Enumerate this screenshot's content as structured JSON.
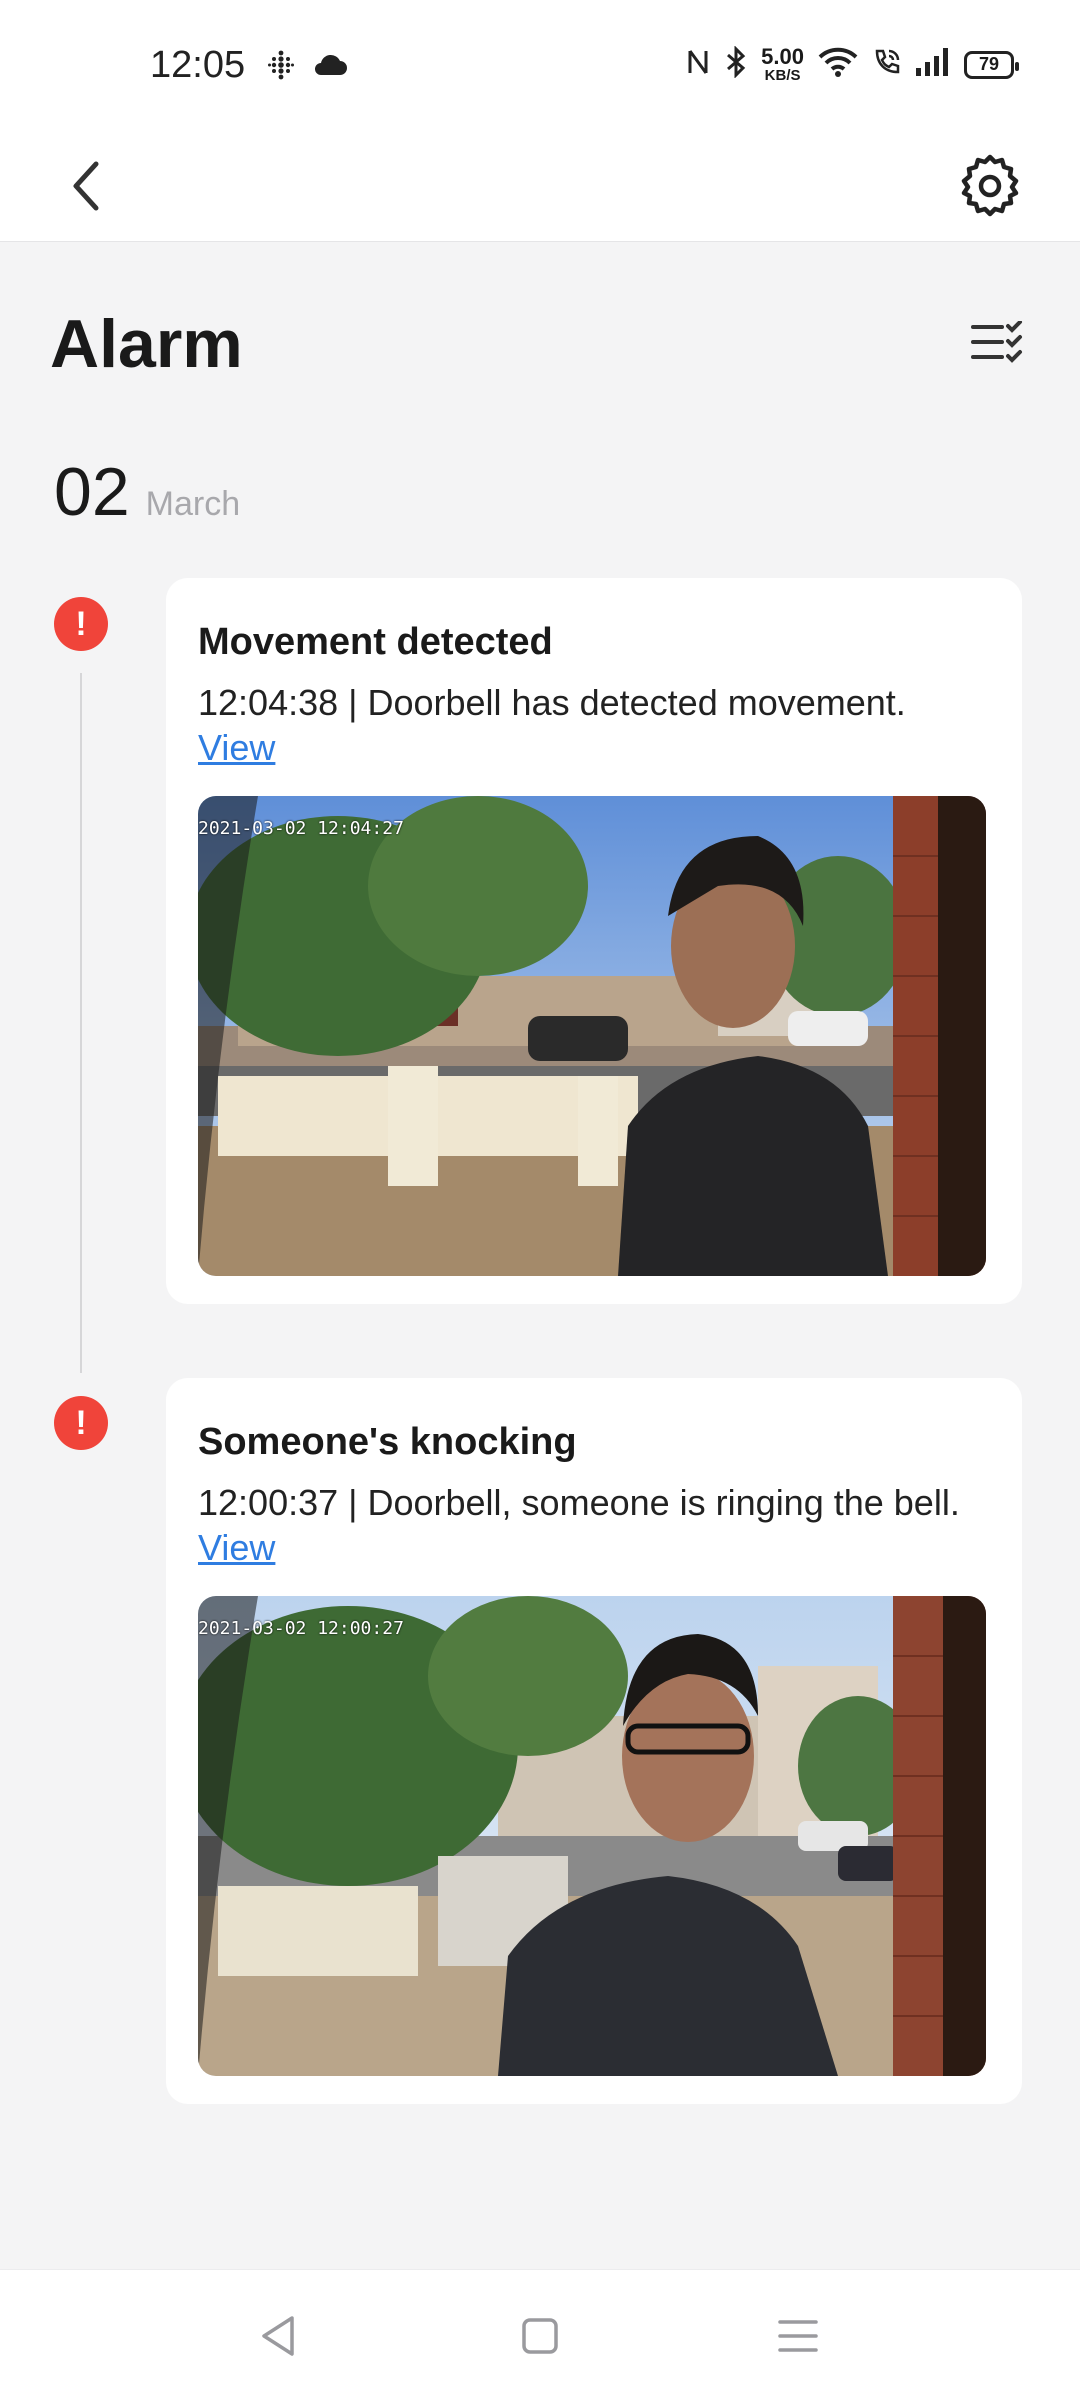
{
  "status_bar": {
    "time": "12:05",
    "net_speed_value": "5.00",
    "net_speed_unit": "KB/S",
    "battery": "79",
    "icons": [
      "fitbit-icon",
      "cloud-icon",
      "nfc-icon",
      "bluetooth-icon",
      "wifi-icon",
      "wifi-call-icon",
      "signal-icon",
      "battery-icon"
    ]
  },
  "header": {
    "back_icon": "chevron-left-icon",
    "settings_icon": "gear-icon"
  },
  "page": {
    "title": "Alarm",
    "filter_icon": "checklist-icon"
  },
  "date": {
    "day": "02",
    "month": "March"
  },
  "events": [
    {
      "title": "Movement detected",
      "description": "12:04:38 | Doorbell has detected movement.",
      "link_label": "View",
      "timestamp_overlay": "2021-03-02 12:04:27"
    },
    {
      "title": "Someone's knocking",
      "description": "12:00:37 | Doorbell, someone is ringing the bell.",
      "link_label": "View",
      "timestamp_overlay": "2021-03-02 12:00:27"
    }
  ],
  "nav_bar": {
    "icons": [
      "back-triangle-icon",
      "home-square-icon",
      "menu-lines-icon"
    ]
  },
  "colors": {
    "accent_link": "#2f7de1",
    "alert": "#f0443a",
    "background": "#f4f4f5"
  }
}
